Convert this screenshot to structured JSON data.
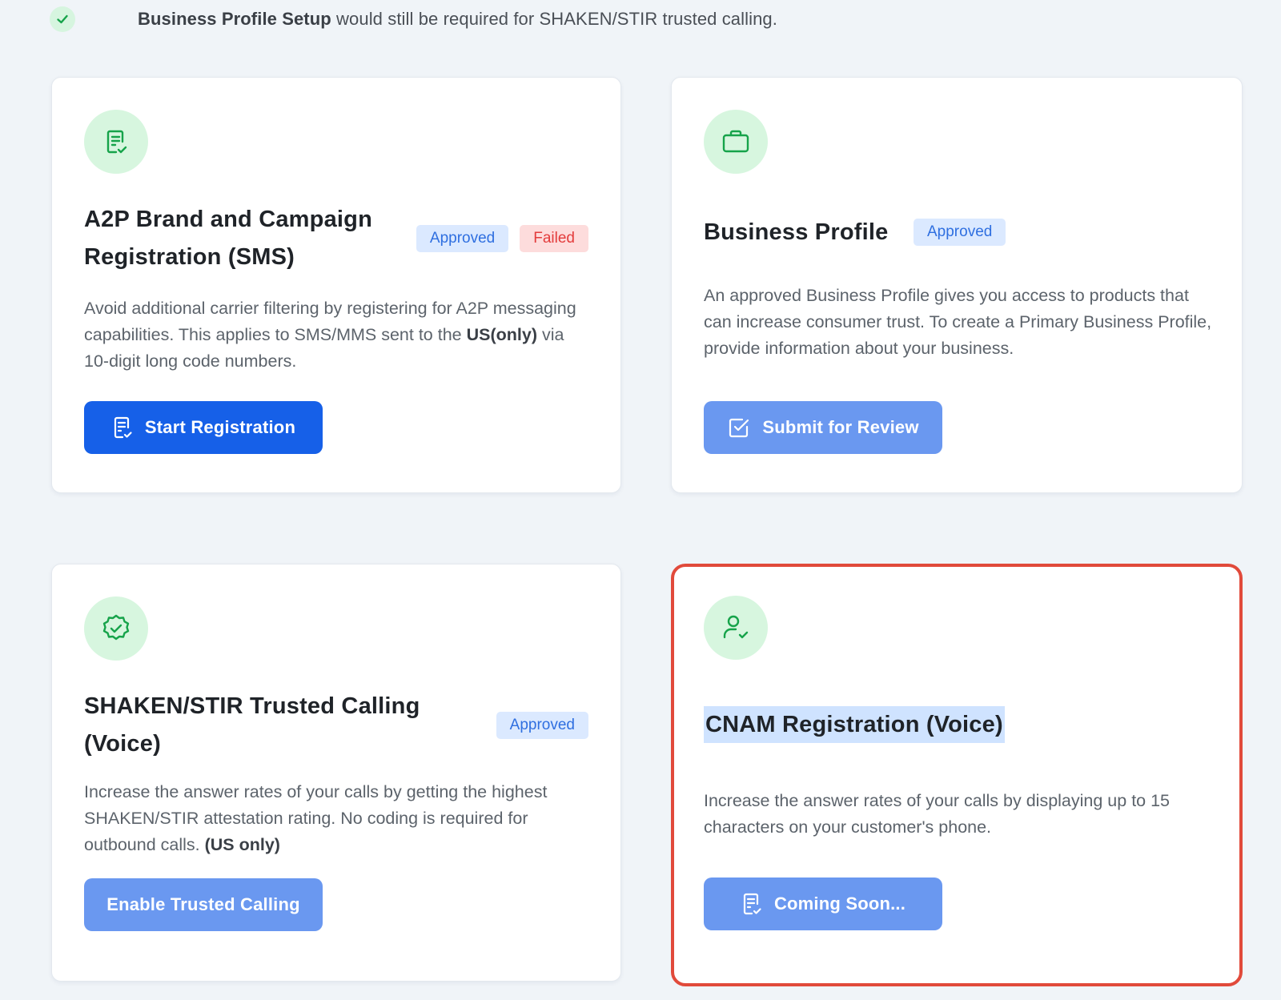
{
  "notice": {
    "bold": "Business Profile Setup",
    "text": " would still be required for SHAKEN/STIR trusted calling."
  },
  "colors": {
    "primary": "#1660e8",
    "primary_muted": "#6a98f0",
    "icon_bg": "#d7f6df",
    "icon_fg": "#16a34a",
    "approved_bg": "#dbe9ff",
    "failed_bg": "#fddcdc",
    "highlight_border": "#e14a3b"
  },
  "cards": [
    {
      "icon": "document-check-icon",
      "title": "A2P Brand and Campaign Registration (SMS)",
      "badges": [
        "Approved",
        "Failed"
      ],
      "desc_1": "Avoid additional carrier filtering by registering for A2P messaging capabilities. This applies to SMS/MMS sent to the ",
      "desc_bold": "US(only)",
      "desc_2": " via 10-digit long code numbers.",
      "button": "Start Registration"
    },
    {
      "icon": "briefcase-icon",
      "title": "Business Profile",
      "badges": [
        "Approved"
      ],
      "desc_1": "An approved Business Profile gives you access to products that can increase consumer trust. To create a Primary Business Profile, provide information about your business.",
      "button": "Submit for Review"
    },
    {
      "icon": "verified-badge-icon",
      "title": "SHAKEN/STIR Trusted Calling (Voice)",
      "badges": [
        "Approved"
      ],
      "desc_1": "Increase the answer rates of your calls by getting the highest SHAKEN/STIR attestation rating. No coding is required for outbound calls. ",
      "desc_bold": "(US only)",
      "button": "Enable Trusted Calling"
    },
    {
      "icon": "user-check-icon",
      "title": "CNAM Registration (Voice)",
      "desc_1": "Increase the answer rates of your calls by displaying up to 15 characters on your customer's phone.",
      "button": "Coming Soon..."
    }
  ]
}
